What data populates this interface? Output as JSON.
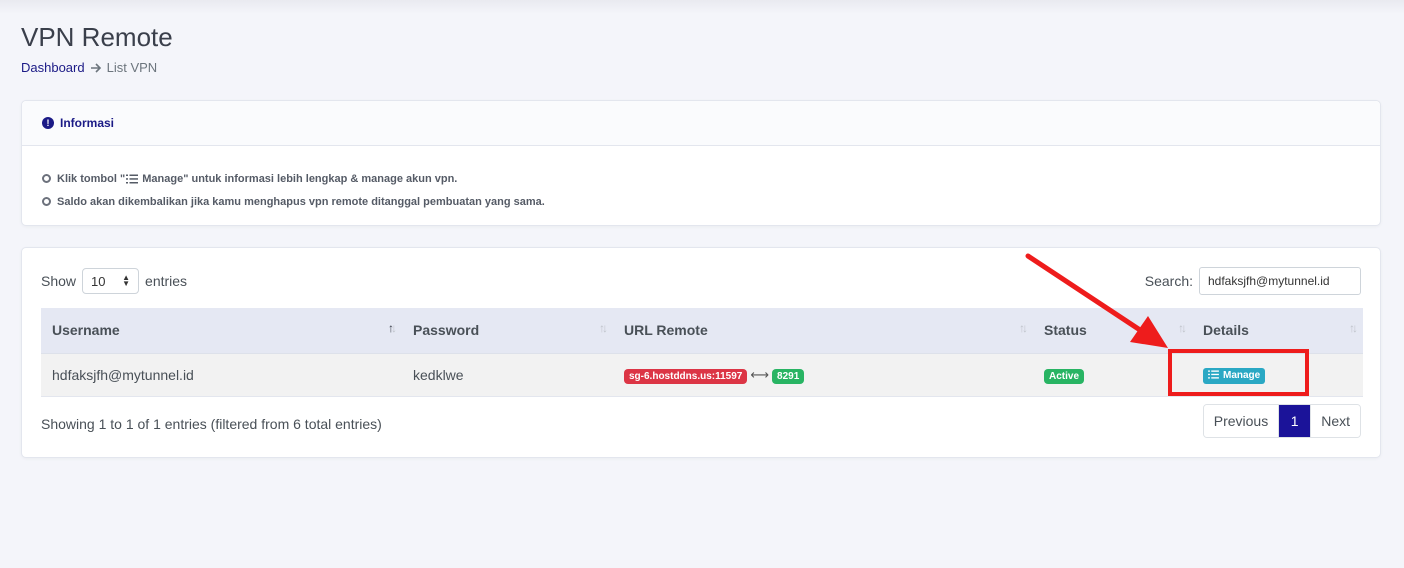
{
  "page": {
    "title": "VPN Remote",
    "breadcrumb": {
      "home": "Dashboard",
      "current": "List VPN"
    }
  },
  "info": {
    "title": "Informasi",
    "line1_prefix": "Klik tombol \"",
    "line1_button": "Manage",
    "line1_suffix": "\" untuk informasi lebih lengkap & manage akun vpn.",
    "line2": "Saldo akan dikembalikan jika kamu menghapus vpn remote ditanggal pembuatan yang sama."
  },
  "table_controls": {
    "show_label": "Show",
    "entries_value": "10",
    "entries_label": "entries",
    "search_label": "Search:",
    "search_value": "hdfaksjfh@mytunnel.id"
  },
  "table": {
    "headers": [
      "Username",
      "Password",
      "URL Remote",
      "Status",
      "Details"
    ],
    "rows": [
      {
        "username": "hdfaksjfh@mytunnel.id",
        "password": "kedklwe",
        "url_host": "sg-6.hostddns.us:11597",
        "url_port": "8291",
        "status": "Active",
        "details_button": "Manage"
      }
    ]
  },
  "footer": {
    "info": "Showing 1 to 1 of 1 entries (filtered from 6 total entries)",
    "pagination": {
      "previous": "Previous",
      "current": "1",
      "next": "Next"
    }
  },
  "colors": {
    "primary": "#1b1a86",
    "active_page": "#1b1399",
    "badge_red": "#dc3545",
    "badge_green": "#28b463",
    "manage_button": "#2aa8c4",
    "annotation": "#ee1c1c"
  }
}
